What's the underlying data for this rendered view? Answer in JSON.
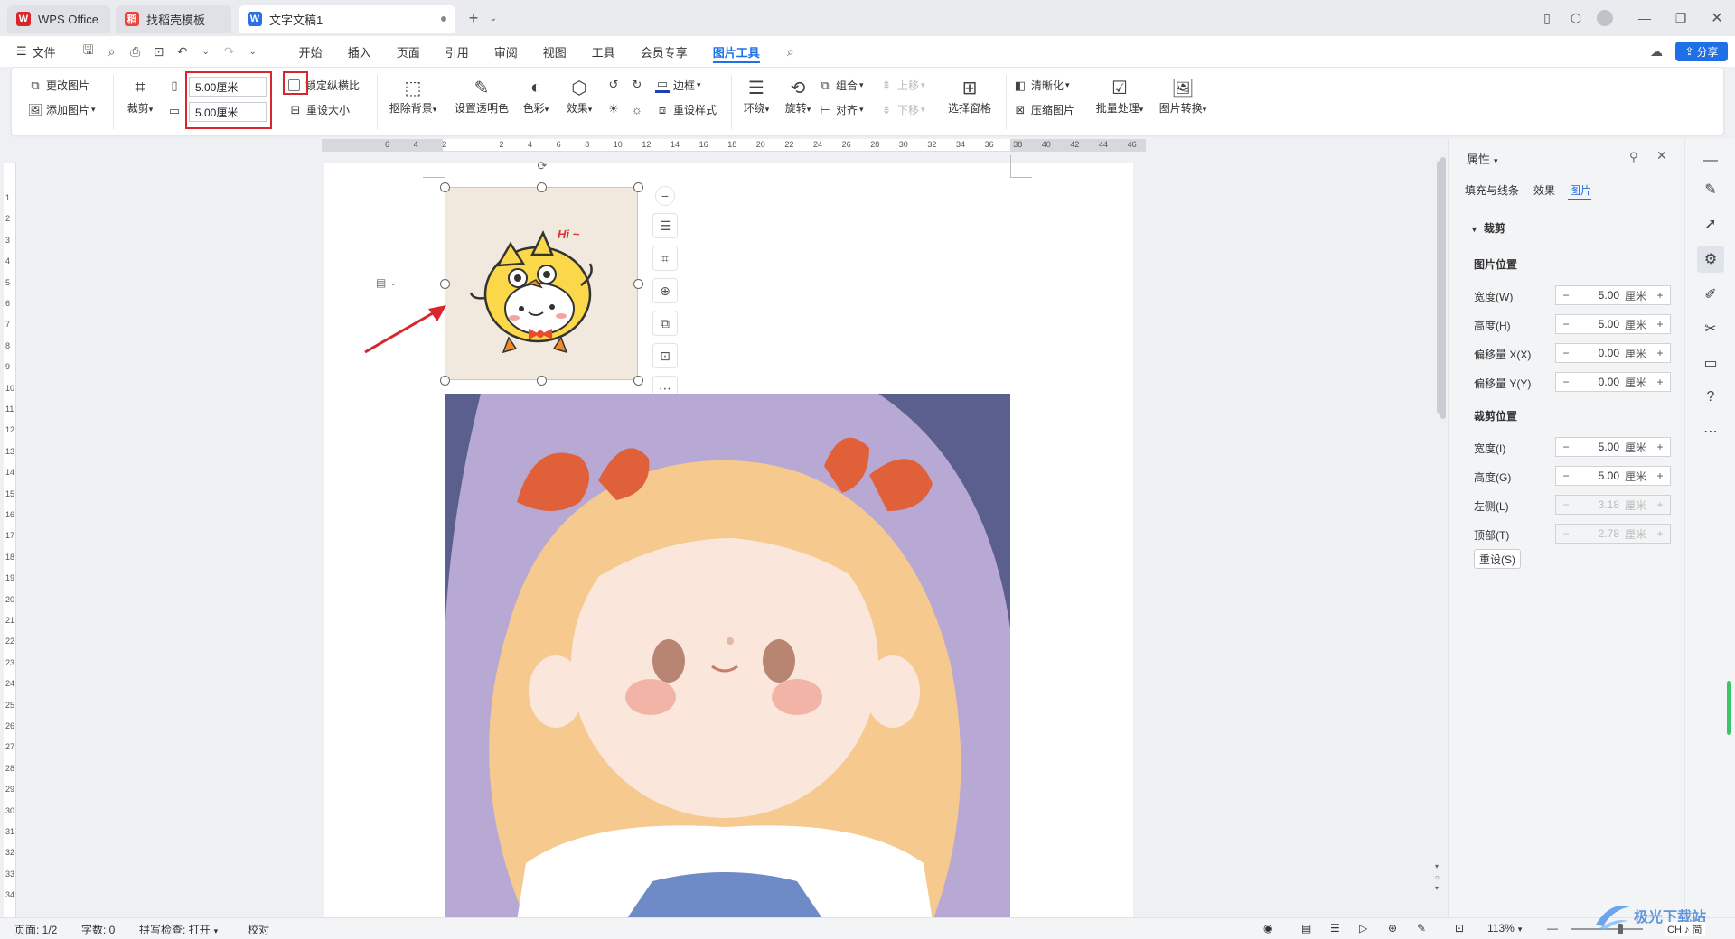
{
  "tabs": [
    {
      "label": "WPS Office",
      "icon": "wps-logo-icon",
      "color": "#d9262c"
    },
    {
      "label": "找稻壳模板",
      "icon": "docer-logo-icon",
      "color": "#e8453c"
    },
    {
      "label": "文字文稿1",
      "icon": "writer-logo-icon",
      "color": "#2b6fe6"
    }
  ],
  "menu": {
    "file": "文件",
    "items": [
      "开始",
      "插入",
      "页面",
      "引用",
      "审阅",
      "视图",
      "工具",
      "会员专享",
      "图片工具"
    ],
    "active": "图片工具",
    "share": "分享"
  },
  "ribbon": {
    "change_picture": "更改图片",
    "add_picture": "添加图片",
    "crop": "裁剪",
    "width_value": "5.00厘米",
    "height_value": "5.00厘米",
    "lock_ratio": "锁定纵横比",
    "reset_size": "重设大小",
    "remove_bg": "抠除背景",
    "set_transparent": "设置透明色",
    "color": "色彩",
    "effects": "效果",
    "border": "边框",
    "reset_style": "重设样式",
    "wrap": "环绕",
    "rotate": "旋转",
    "group": "组合",
    "align": "对齐",
    "bring_forward": "上移",
    "send_backward": "下移",
    "selection_pane": "选择窗格",
    "sharpen": "清晰化",
    "compress": "压缩图片",
    "batch": "批量处理",
    "convert": "图片转换"
  },
  "ruler_h": [
    "6",
    "4",
    "2",
    "",
    "2",
    "4",
    "6",
    "8",
    "10",
    "12",
    "14",
    "16",
    "18",
    "20",
    "22",
    "24",
    "26",
    "28",
    "30",
    "32",
    "34",
    "36",
    "38",
    "40",
    "42",
    "44",
    "46"
  ],
  "ruler_v": [
    "1",
    "2",
    "3",
    "4",
    "5",
    "6",
    "7",
    "8",
    "9",
    "10",
    "11",
    "12",
    "13",
    "14",
    "15",
    "16",
    "17",
    "18",
    "19",
    "20",
    "21",
    "22",
    "23",
    "24",
    "25",
    "26",
    "27",
    "28",
    "29",
    "30",
    "31",
    "32",
    "33",
    "34"
  ],
  "sticker_text": "Hi ~",
  "panel": {
    "title": "属性",
    "tabs": [
      "填充与线条",
      "效果",
      "图片"
    ],
    "active_tab": "图片",
    "section": "裁剪",
    "group1": "图片位置",
    "group2": "裁剪位置",
    "rows1": [
      {
        "label": "宽度(W)",
        "value": "5.00",
        "unit": "厘米"
      },
      {
        "label": "高度(H)",
        "value": "5.00",
        "unit": "厘米"
      },
      {
        "label": "偏移量 X(X)",
        "value": "0.00",
        "unit": "厘米"
      },
      {
        "label": "偏移量 Y(Y)",
        "value": "0.00",
        "unit": "厘米"
      }
    ],
    "rows2": [
      {
        "label": "宽度(I)",
        "value": "5.00",
        "unit": "厘米"
      },
      {
        "label": "高度(G)",
        "value": "5.00",
        "unit": "厘米"
      },
      {
        "label": "左侧(L)",
        "value": "3.18",
        "unit": "厘米"
      },
      {
        "label": "顶部(T)",
        "value": "2.78",
        "unit": "厘米"
      }
    ],
    "reset": "重设(S)"
  },
  "status": {
    "page": "页面: 1/2",
    "words": "字数: 0",
    "spell": "拼写检查: 打开",
    "proof": "校对",
    "zoom": "113%"
  },
  "watermark": "极光下载站",
  "ime": "CH ♪ 简"
}
